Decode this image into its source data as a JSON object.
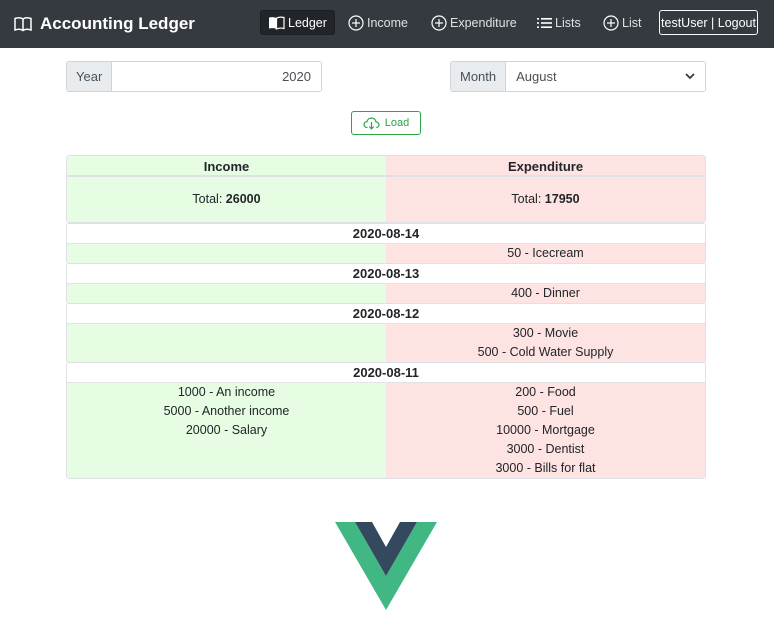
{
  "app": {
    "title": "Accounting Ledger",
    "logo_icon": "book-open-icon"
  },
  "nav": {
    "ledger": "Ledger",
    "income": "Income",
    "expenditure": "Expenditure",
    "lists": "Lists",
    "list": "List",
    "user_logout": "testUser | Logout"
  },
  "filters": {
    "year_label": "Year",
    "year_value": "2020",
    "month_label": "Month",
    "month_value": "August"
  },
  "load_label": "Load",
  "table": {
    "income_header": "Income",
    "expenditure_header": "Expenditure",
    "total_label": "Total:",
    "income_total": "26000",
    "expenditure_total": "17950",
    "days": [
      {
        "date": "2020-08-14",
        "income": [],
        "expenditure": [
          "50 - Icecream"
        ]
      },
      {
        "date": "2020-08-13",
        "income": [],
        "expenditure": [
          "400 - Dinner"
        ]
      },
      {
        "date": "2020-08-12",
        "income": [],
        "expenditure": [
          "300 - Movie",
          "500 - Cold Water Supply"
        ]
      },
      {
        "date": "2020-08-11",
        "income": [
          "1000 - An income",
          "5000 - Another income",
          "20000 - Salary"
        ],
        "expenditure": [
          "200 - Food",
          "500 - Fuel",
          "10000 - Mortgage",
          "3000 - Dentist",
          "3000 - Bills for flat"
        ]
      }
    ]
  },
  "colors": {
    "navbar": "#343a40",
    "income_bg": "#e6fde4",
    "expenditure_bg": "#fde3e2",
    "load_green": "#28a745",
    "vue_green": "#41b883",
    "vue_dark": "#34495e"
  }
}
